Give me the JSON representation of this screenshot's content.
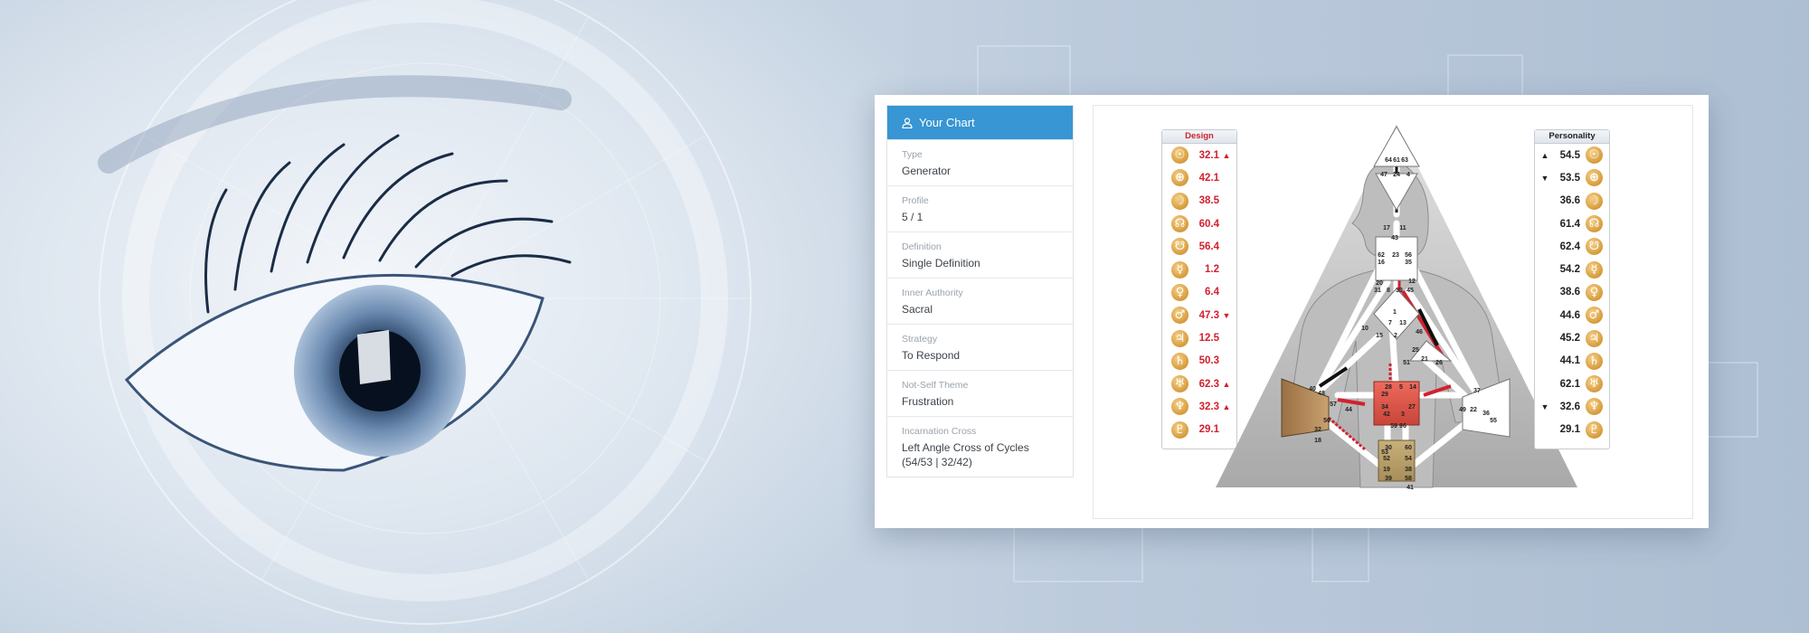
{
  "panel": {
    "header": "Your Chart",
    "rows": [
      {
        "label": "Type",
        "value": "Generator"
      },
      {
        "label": "Profile",
        "value": "5 / 1"
      },
      {
        "label": "Definition",
        "value": "Single Definition"
      },
      {
        "label": "Inner Authority",
        "value": "Sacral"
      },
      {
        "label": "Strategy",
        "value": "To Respond"
      },
      {
        "label": "Not-Self Theme",
        "value": "Frustration"
      },
      {
        "label": "Incarnation Cross",
        "value": "Left Angle Cross of Cycles (54/53 | 32/42)"
      }
    ]
  },
  "design": {
    "title": "Design",
    "rows": [
      {
        "glyph": "☉",
        "value": "32.1",
        "arrow": "▲"
      },
      {
        "glyph": "⊕",
        "value": "42.1",
        "arrow": ""
      },
      {
        "glyph": "☽",
        "value": "38.5",
        "arrow": ""
      },
      {
        "glyph": "☊",
        "value": "60.4",
        "arrow": ""
      },
      {
        "glyph": "☋",
        "value": "56.4",
        "arrow": ""
      },
      {
        "glyph": "☿",
        "value": "1.2",
        "arrow": ""
      },
      {
        "glyph": "♀",
        "value": "6.4",
        "arrow": ""
      },
      {
        "glyph": "♂",
        "value": "47.3",
        "arrow": "▼"
      },
      {
        "glyph": "♃",
        "value": "12.5",
        "arrow": ""
      },
      {
        "glyph": "♄",
        "value": "50.3",
        "arrow": ""
      },
      {
        "glyph": "♅",
        "value": "62.3",
        "arrow": "▲"
      },
      {
        "glyph": "♆",
        "value": "32.3",
        "arrow": "▲"
      },
      {
        "glyph": "♇",
        "value": "29.1",
        "arrow": ""
      }
    ]
  },
  "personality": {
    "title": "Personality",
    "rows": [
      {
        "glyph": "☉",
        "value": "54.5",
        "arrow": "▲"
      },
      {
        "glyph": "⊕",
        "value": "53.5",
        "arrow": "▼"
      },
      {
        "glyph": "☽",
        "value": "36.6",
        "arrow": ""
      },
      {
        "glyph": "☊",
        "value": "61.4",
        "arrow": ""
      },
      {
        "glyph": "☋",
        "value": "62.4",
        "arrow": ""
      },
      {
        "glyph": "☿",
        "value": "54.2",
        "arrow": ""
      },
      {
        "glyph": "♀",
        "value": "38.6",
        "arrow": ""
      },
      {
        "glyph": "♂",
        "value": "44.6",
        "arrow": ""
      },
      {
        "glyph": "♃",
        "value": "45.2",
        "arrow": ""
      },
      {
        "glyph": "♄",
        "value": "44.1",
        "arrow": ""
      },
      {
        "glyph": "♅",
        "value": "62.1",
        "arrow": ""
      },
      {
        "glyph": "♆",
        "value": "32.6",
        "arrow": "▼"
      },
      {
        "glyph": "♇",
        "value": "29.1",
        "arrow": ""
      }
    ]
  },
  "colors": {
    "accent": "#3796d3",
    "design_red": "#d3202e",
    "planet_gold": "#d69a3a",
    "sacral": "#e0564a",
    "spleen": "#b5895a",
    "root": "#b89d6a"
  },
  "icons": {
    "header": "user-icon"
  },
  "bodygraph": {
    "gates": [
      "64",
      "61",
      "63",
      "47",
      "24",
      "4",
      "17",
      "11",
      "43",
      "62",
      "23",
      "56",
      "16",
      "35",
      "20",
      "12",
      "31",
      "8",
      "33",
      "45",
      "1",
      "7",
      "13",
      "10",
      "15",
      "2",
      "46",
      "25",
      "21",
      "51",
      "26",
      "40",
      "48",
      "57",
      "44",
      "50",
      "32",
      "18",
      "28",
      "5",
      "14",
      "29",
      "34",
      "27",
      "42",
      "3",
      "59",
      "9",
      "6",
      "37",
      "49",
      "22",
      "36",
      "55",
      "30",
      "53",
      "60",
      "52",
      "54",
      "19",
      "38",
      "39",
      "58",
      "41"
    ]
  }
}
